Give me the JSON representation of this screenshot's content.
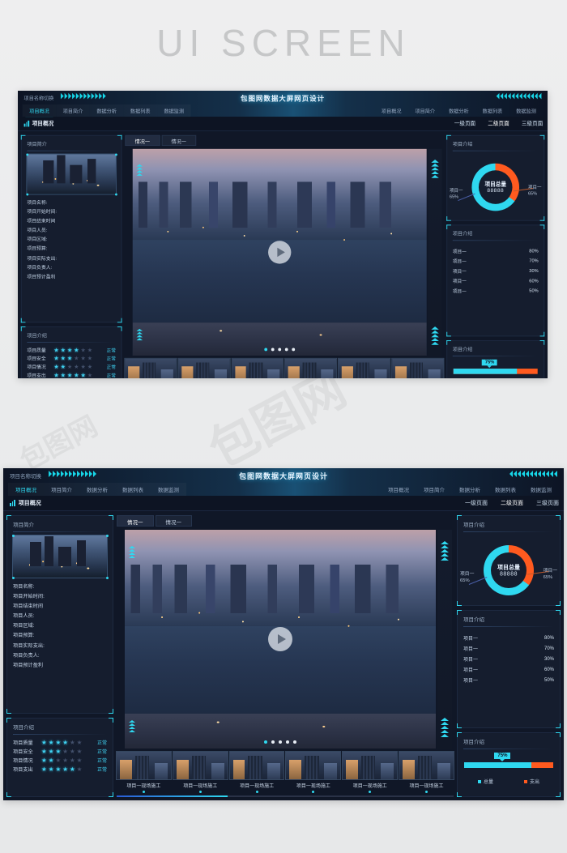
{
  "poster": {
    "heading": "UI SCREEN",
    "watermark": "包图网"
  },
  "dashboard": {
    "topbar": {
      "switch_label": "项目名称切换",
      "title": "包图网数据大屏网页设计"
    },
    "nav_tabs": [
      {
        "label": "项目概况",
        "active": true
      },
      {
        "label": "项目简介",
        "active": false
      },
      {
        "label": "数据分析",
        "active": false
      },
      {
        "label": "数据列表",
        "active": false
      },
      {
        "label": "数据监测",
        "active": false
      }
    ],
    "section": {
      "label": "项目概况",
      "icon": "bar-chart-icon"
    },
    "breadcrumbs": [
      {
        "label": "一级页面",
        "active": false
      },
      {
        "label": "二级页面",
        "active": true
      },
      {
        "label": "三级页面",
        "active": false
      }
    ],
    "left": {
      "info_panel": {
        "title": "项目简介",
        "fields": [
          "项目名称:",
          "项目开始时间:",
          "项目结束时间",
          "项目人员:",
          "项目区域:",
          "项目预算:",
          "项目实际支出:",
          "项目负责人:",
          "项目预计盈利"
        ]
      },
      "rating_panel": {
        "title": "项目介绍",
        "max_stars": 6,
        "rows": [
          {
            "label": "项目质量",
            "stars": 4,
            "status": "正常"
          },
          {
            "label": "项目安全",
            "stars": 3,
            "status": "正常"
          },
          {
            "label": "项目情况",
            "stars": 2,
            "status": "正常"
          },
          {
            "label": "项目支出",
            "stars": 5,
            "status": "正常"
          }
        ]
      }
    },
    "center": {
      "video_tabs": [
        {
          "label": "情况一",
          "active": true
        },
        {
          "label": "情况一",
          "active": false
        }
      ],
      "player": {
        "play_icon": "play-icon",
        "slides": 5,
        "active_slide": 1
      },
      "thumbnails": [
        {
          "caption": "项目一现场施工"
        },
        {
          "caption": "项目一现场施工"
        },
        {
          "caption": "项目一现场施工"
        },
        {
          "caption": "项目一现场施工"
        },
        {
          "caption": "项目一现场施工"
        },
        {
          "caption": "项目一现场施工"
        }
      ]
    },
    "right": {
      "donut_panel": {
        "title": "项目介绍",
        "center_label": "项目总量",
        "center_value": "88888",
        "left_label": "项目一",
        "left_value": "65%",
        "right_label": "项目一",
        "right_value": "65%"
      },
      "bars_panel": {
        "title": "项目介绍",
        "rows": [
          {
            "label": "项目一",
            "pct": "80%",
            "value": 80
          },
          {
            "label": "项目一",
            "pct": "70%",
            "value": 70
          },
          {
            "label": "项目一",
            "pct": "30%",
            "value": 30
          },
          {
            "label": "项目一",
            "pct": "60%",
            "value": 60
          },
          {
            "label": "项目一",
            "pct": "50%",
            "value": 50
          }
        ]
      },
      "progress_panel": {
        "title": "项目介绍",
        "tooltip": "75%",
        "value": 75,
        "legend": [
          {
            "label": "总量",
            "color": "#2fd8f0"
          },
          {
            "label": "支出",
            "color": "#ff5a1f"
          }
        ]
      }
    }
  },
  "chart_data": [
    {
      "type": "pie",
      "title": "项目总量",
      "center_value": "88888",
      "labels": [
        "项目一",
        "项目一"
      ],
      "values": [
        65,
        35
      ],
      "colors": [
        "#2fd8f0",
        "#ff5a1f"
      ],
      "legend": "side-callouts"
    },
    {
      "type": "bar",
      "title": "项目介绍",
      "orientation": "horizontal",
      "categories": [
        "项目一",
        "项目一",
        "项目一",
        "项目一",
        "项目一"
      ],
      "values": [
        80,
        70,
        30,
        60,
        50
      ],
      "xlabel": "",
      "ylabel": "",
      "ylim": [
        0,
        100
      ],
      "grid": false
    },
    {
      "type": "bar",
      "title": "项目介绍",
      "orientation": "stacked-horizontal",
      "categories": [
        "总量",
        "支出"
      ],
      "values": [
        75,
        25
      ],
      "annotation": "75%",
      "colors": [
        "#2fd8f0",
        "#ff5a1f"
      ],
      "legend": "bottom"
    }
  ]
}
